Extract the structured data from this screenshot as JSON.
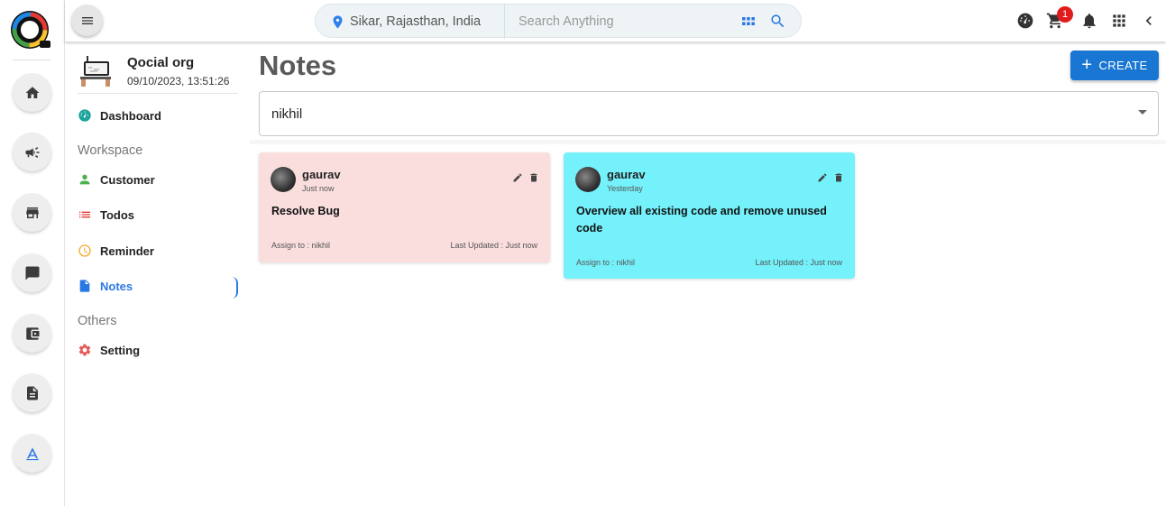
{
  "topbar": {
    "location": "Sikar, Rajasthan, India",
    "search_placeholder": "Search Anything",
    "cart_count": "1"
  },
  "sidebar": {
    "org_name": "Qocial org",
    "org_datetime": "09/10/2023, 13:51:26",
    "items": [
      {
        "label": "Dashboard",
        "icon": "dashboard-icon",
        "color": "#1aa39a"
      },
      {
        "label": "Customer",
        "icon": "person-icon",
        "color": "#4caf50"
      },
      {
        "label": "Todos",
        "icon": "list-icon",
        "color": "#e53935"
      },
      {
        "label": "Reminder",
        "icon": "clock-icon",
        "color": "#f5a623"
      },
      {
        "label": "Notes",
        "icon": "document-icon",
        "color": "#2a78e4",
        "active": true
      },
      {
        "label": "Setting",
        "icon": "gear-icon",
        "color": "#e65a5a"
      }
    ],
    "section_workspace": "Workspace",
    "section_others": "Others"
  },
  "main": {
    "title": "Notes",
    "create_label": "CREATE",
    "filter_value": "nikhil",
    "notes": [
      {
        "author": "gaurav",
        "time": "Just now",
        "text": "Resolve Bug",
        "assign": "Assign to : nikhil",
        "updated": "Last Updated : Just now",
        "bg": "#fadede"
      },
      {
        "author": "gaurav",
        "time": "Yesterday",
        "text": "Overview all existing code and remove unused code",
        "assign": "Assign to : nikhil",
        "updated": "Last Updated : Just now",
        "bg": "#74f1fa"
      }
    ]
  },
  "colors": {
    "accent": "#1976d2",
    "badge": "#e21b1b"
  }
}
